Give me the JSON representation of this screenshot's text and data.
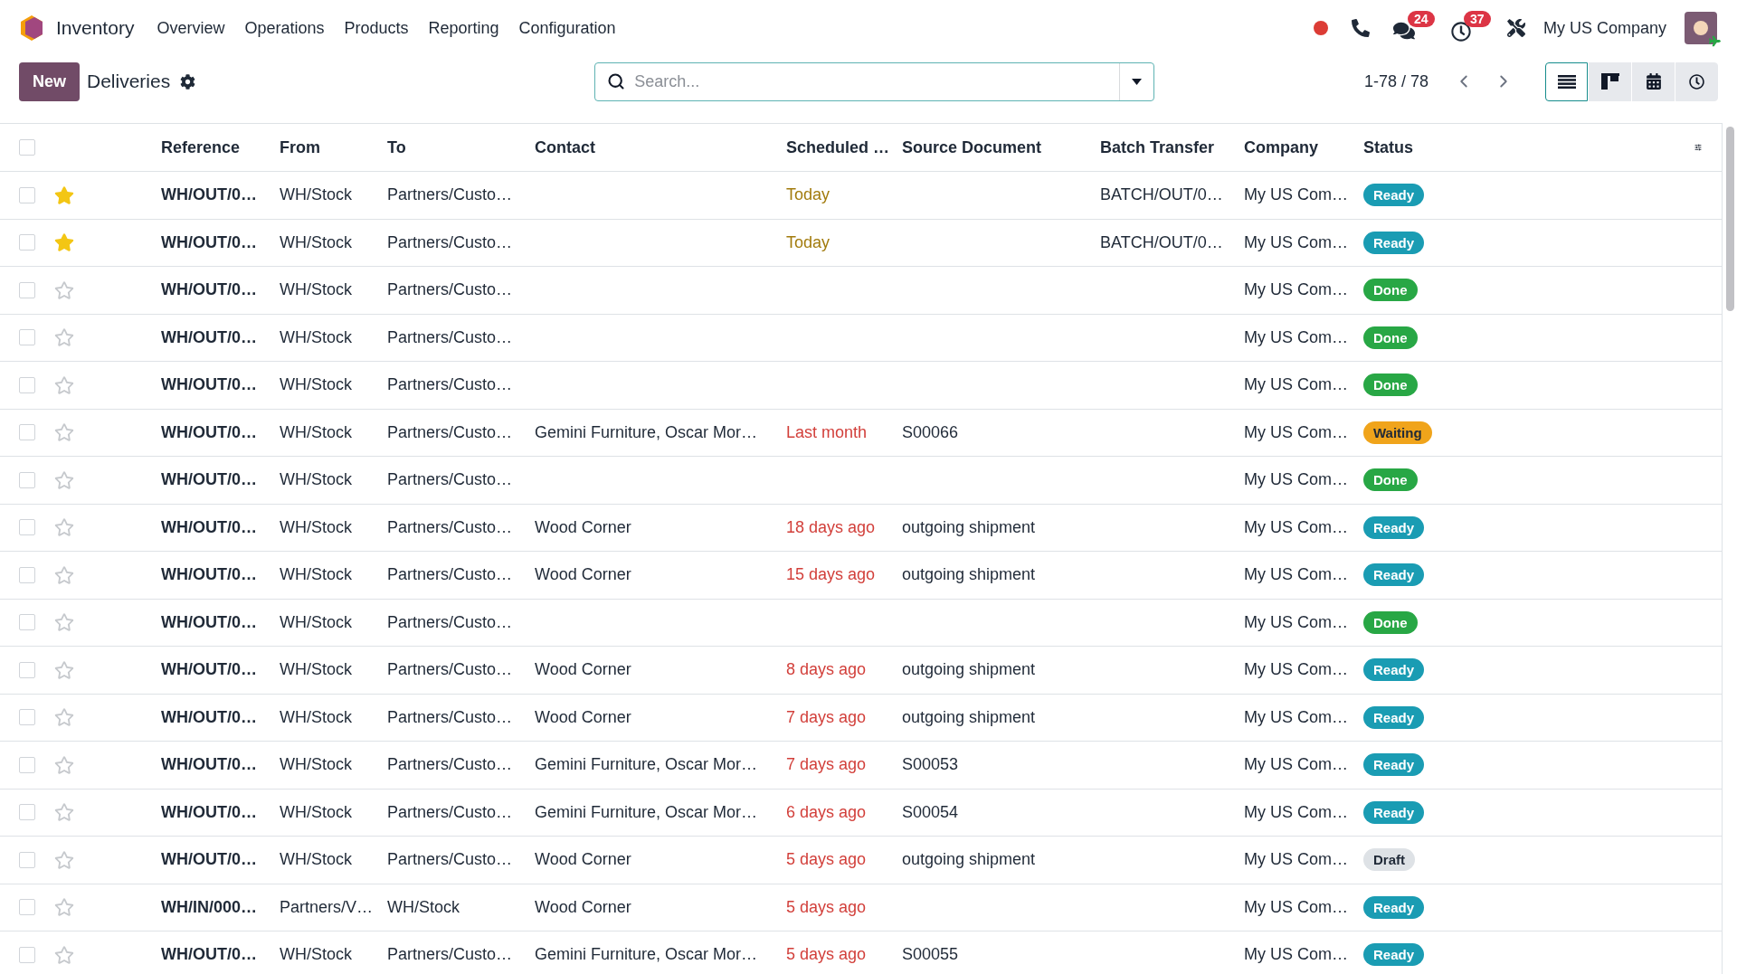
{
  "navbar": {
    "app_name": "Inventory",
    "menu": [
      "Overview",
      "Operations",
      "Products",
      "Reporting",
      "Configuration"
    ],
    "chat_count": "24",
    "activity_count": "37",
    "company": "My US Company"
  },
  "control_panel": {
    "new_button": "New",
    "title": "Deliveries",
    "search": {
      "placeholder": "Search..."
    },
    "pager": "1-78 / 78",
    "views": [
      {
        "kind": "list",
        "selected": true
      },
      {
        "kind": "kanban",
        "selected": false
      },
      {
        "kind": "calendar",
        "selected": false
      },
      {
        "kind": "activity",
        "selected": false
      }
    ]
  },
  "table": {
    "select_all": {
      "checked": false
    },
    "columns": [
      "Reference",
      "From",
      "To",
      "Contact",
      "Scheduled …",
      "Source Document",
      "Batch Transfer",
      "Company",
      "Status"
    ],
    "rows": [
      {
        "selected": false,
        "starred": true,
        "reference": "WH/OUT/0…",
        "from": "WH/Stock",
        "to": "Partners/Custo…",
        "scheduled": {
          "text": "Today",
          "color": "#a27b0d"
        },
        "batch": "BATCH/OUT/0…",
        "company": "My US Com…",
        "status": {
          "kind": "ready",
          "label": "Ready"
        }
      },
      {
        "selected": false,
        "starred": true,
        "reference": "WH/OUT/0…",
        "from": "WH/Stock",
        "to": "Partners/Custo…",
        "scheduled": {
          "text": "Today",
          "color": "#a27b0d"
        },
        "batch": "BATCH/OUT/0…",
        "company": "My US Com…",
        "status": {
          "kind": "ready",
          "label": "Ready"
        }
      },
      {
        "selected": false,
        "starred": false,
        "reference": "WH/OUT/0…",
        "from": "WH/Stock",
        "to": "Partners/Custo…",
        "company": "My US Com…",
        "status": {
          "kind": "done",
          "label": "Done"
        }
      },
      {
        "selected": false,
        "starred": false,
        "reference": "WH/OUT/0…",
        "from": "WH/Stock",
        "to": "Partners/Custo…",
        "company": "My US Com…",
        "status": {
          "kind": "done",
          "label": "Done"
        }
      },
      {
        "selected": false,
        "starred": false,
        "reference": "WH/OUT/0…",
        "from": "WH/Stock",
        "to": "Partners/Custo…",
        "company": "My US Com…",
        "status": {
          "kind": "done",
          "label": "Done"
        }
      },
      {
        "selected": false,
        "starred": false,
        "reference": "WH/OUT/0…",
        "from": "WH/Stock",
        "to": "Partners/Custo…",
        "contact": "Gemini Furniture, Oscar Mor…",
        "scheduled": {
          "text": "Last month",
          "color": "#d23f3a"
        },
        "source": "S00066",
        "company": "My US Com…",
        "status": {
          "kind": "waiting",
          "label": "Waiting"
        }
      },
      {
        "selected": false,
        "starred": false,
        "reference": "WH/OUT/0…",
        "from": "WH/Stock",
        "to": "Partners/Custo…",
        "company": "My US Com…",
        "status": {
          "kind": "done",
          "label": "Done"
        }
      },
      {
        "selected": false,
        "starred": false,
        "reference": "WH/OUT/0…",
        "from": "WH/Stock",
        "to": "Partners/Custo…",
        "contact": "Wood Corner",
        "scheduled": {
          "text": "18 days ago",
          "color": "#d23f3a"
        },
        "source": "outgoing shipment",
        "company": "My US Com…",
        "status": {
          "kind": "ready",
          "label": "Ready"
        }
      },
      {
        "selected": false,
        "starred": false,
        "reference": "WH/OUT/0…",
        "from": "WH/Stock",
        "to": "Partners/Custo…",
        "contact": "Wood Corner",
        "scheduled": {
          "text": "15 days ago",
          "color": "#d23f3a"
        },
        "source": "outgoing shipment",
        "company": "My US Com…",
        "status": {
          "kind": "ready",
          "label": "Ready"
        }
      },
      {
        "selected": false,
        "starred": false,
        "reference": "WH/OUT/0…",
        "from": "WH/Stock",
        "to": "Partners/Custo…",
        "company": "My US Com…",
        "status": {
          "kind": "done",
          "label": "Done"
        }
      },
      {
        "selected": false,
        "starred": false,
        "reference": "WH/OUT/0…",
        "from": "WH/Stock",
        "to": "Partners/Custo…",
        "contact": "Wood Corner",
        "scheduled": {
          "text": "8 days ago",
          "color": "#d23f3a"
        },
        "source": "outgoing shipment",
        "company": "My US Com…",
        "status": {
          "kind": "ready",
          "label": "Ready"
        }
      },
      {
        "selected": false,
        "starred": false,
        "reference": "WH/OUT/0…",
        "from": "WH/Stock",
        "to": "Partners/Custo…",
        "contact": "Wood Corner",
        "scheduled": {
          "text": "7 days ago",
          "color": "#d23f3a"
        },
        "source": "outgoing shipment",
        "company": "My US Com…",
        "status": {
          "kind": "ready",
          "label": "Ready"
        }
      },
      {
        "selected": false,
        "starred": false,
        "reference": "WH/OUT/0…",
        "from": "WH/Stock",
        "to": "Partners/Custo…",
        "contact": "Gemini Furniture, Oscar Mor…",
        "scheduled": {
          "text": "7 days ago",
          "color": "#d23f3a"
        },
        "source": "S00053",
        "company": "My US Com…",
        "status": {
          "kind": "ready",
          "label": "Ready"
        }
      },
      {
        "selected": false,
        "starred": false,
        "reference": "WH/OUT/0…",
        "from": "WH/Stock",
        "to": "Partners/Custo…",
        "contact": "Gemini Furniture, Oscar Mor…",
        "scheduled": {
          "text": "6 days ago",
          "color": "#d23f3a"
        },
        "source": "S00054",
        "company": "My US Com…",
        "status": {
          "kind": "ready",
          "label": "Ready"
        }
      },
      {
        "selected": false,
        "starred": false,
        "reference": "WH/OUT/0…",
        "from": "WH/Stock",
        "to": "Partners/Custo…",
        "contact": "Wood Corner",
        "scheduled": {
          "text": "5 days ago",
          "color": "#d23f3a"
        },
        "source": "outgoing shipment",
        "company": "My US Com…",
        "status": {
          "kind": "draft",
          "label": "Draft"
        }
      },
      {
        "selected": false,
        "starred": false,
        "reference": "WH/IN/000…",
        "from": "Partners/V…",
        "to": "WH/Stock",
        "contact": "Wood Corner",
        "scheduled": {
          "text": "5 days ago",
          "color": "#d23f3a"
        },
        "company": "My US Com…",
        "status": {
          "kind": "ready",
          "label": "Ready"
        }
      },
      {
        "selected": false,
        "starred": false,
        "reference": "WH/OUT/0…",
        "from": "WH/Stock",
        "to": "Partners/Custo…",
        "contact": "Gemini Furniture, Oscar Mor…",
        "scheduled": {
          "text": "5 days ago",
          "color": "#d23f3a"
        },
        "source": "S00055",
        "company": "My US Com…",
        "status": {
          "kind": "ready",
          "label": "Ready"
        }
      }
    ]
  }
}
